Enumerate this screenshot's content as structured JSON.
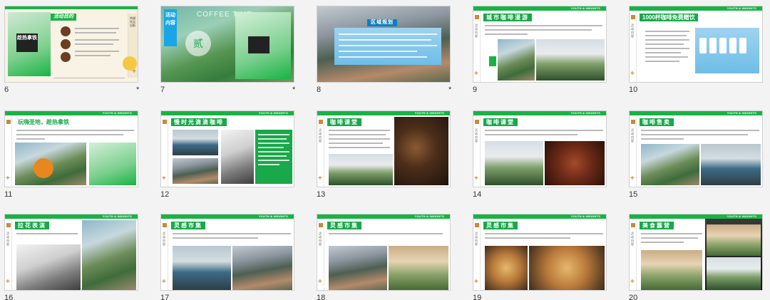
{
  "slides": [
    {
      "number": "6",
      "starred": true,
      "title": "活动目的",
      "tag": "YOUTH & INSIGHTS",
      "poster_text": "趁热拿铁",
      "side_text": "特调饮品出街"
    },
    {
      "number": "7",
      "starred": true,
      "title": "COFFEE TIME",
      "side_text": "活动内容",
      "badge": "贰"
    },
    {
      "number": "8",
      "starred": true,
      "title": "区域规划"
    },
    {
      "number": "9",
      "starred": false,
      "title": "城市咖啡漫游",
      "tag": "YOUTH & INSIGHTS"
    },
    {
      "number": "10",
      "starred": false,
      "title": "1000杯咖啡免费赠饮",
      "tag": "YOUTH & INSIGHTS"
    },
    {
      "number": "11",
      "starred": false,
      "title": "玩嗨圣地，趁热拿铁",
      "tag": "YOUTH & INSIGHTS"
    },
    {
      "number": "12",
      "starred": false,
      "title": "慢时光滴滴咖啡",
      "tag": "YOUTH & INSIGHTS"
    },
    {
      "number": "13",
      "starred": false,
      "title": "咖啡课堂",
      "tag": "YOUTH & INSIGHTS"
    },
    {
      "number": "14",
      "starred": false,
      "title": "咖啡课堂",
      "tag": "YOUTH & INSIGHTS"
    },
    {
      "number": "15",
      "starred": false,
      "title": "咖啡售卖",
      "tag": "YOUTH & INSIGHTS"
    },
    {
      "number": "16",
      "starred": false,
      "title": "拉花表演",
      "tag": "YOUTH & INSIGHTS"
    },
    {
      "number": "17",
      "starred": false,
      "title": "灵感市集",
      "tag": "YOUTH & INSIGHTS"
    },
    {
      "number": "18",
      "starred": false,
      "title": "灵感市集",
      "tag": "YOUTH & INSIGHTS"
    },
    {
      "number": "19",
      "starred": false,
      "title": "灵感市集",
      "tag": "YOUTH & INSIGHTS"
    },
    {
      "number": "20",
      "starred": false,
      "title": "美食露营",
      "tag": "YOUTH & INSIGHTS"
    }
  ],
  "star_glyph": "*",
  "colors": {
    "accent_green": "#19b345",
    "accent_orange": "#d48c2c",
    "panel_blue": "#29a8e8"
  }
}
